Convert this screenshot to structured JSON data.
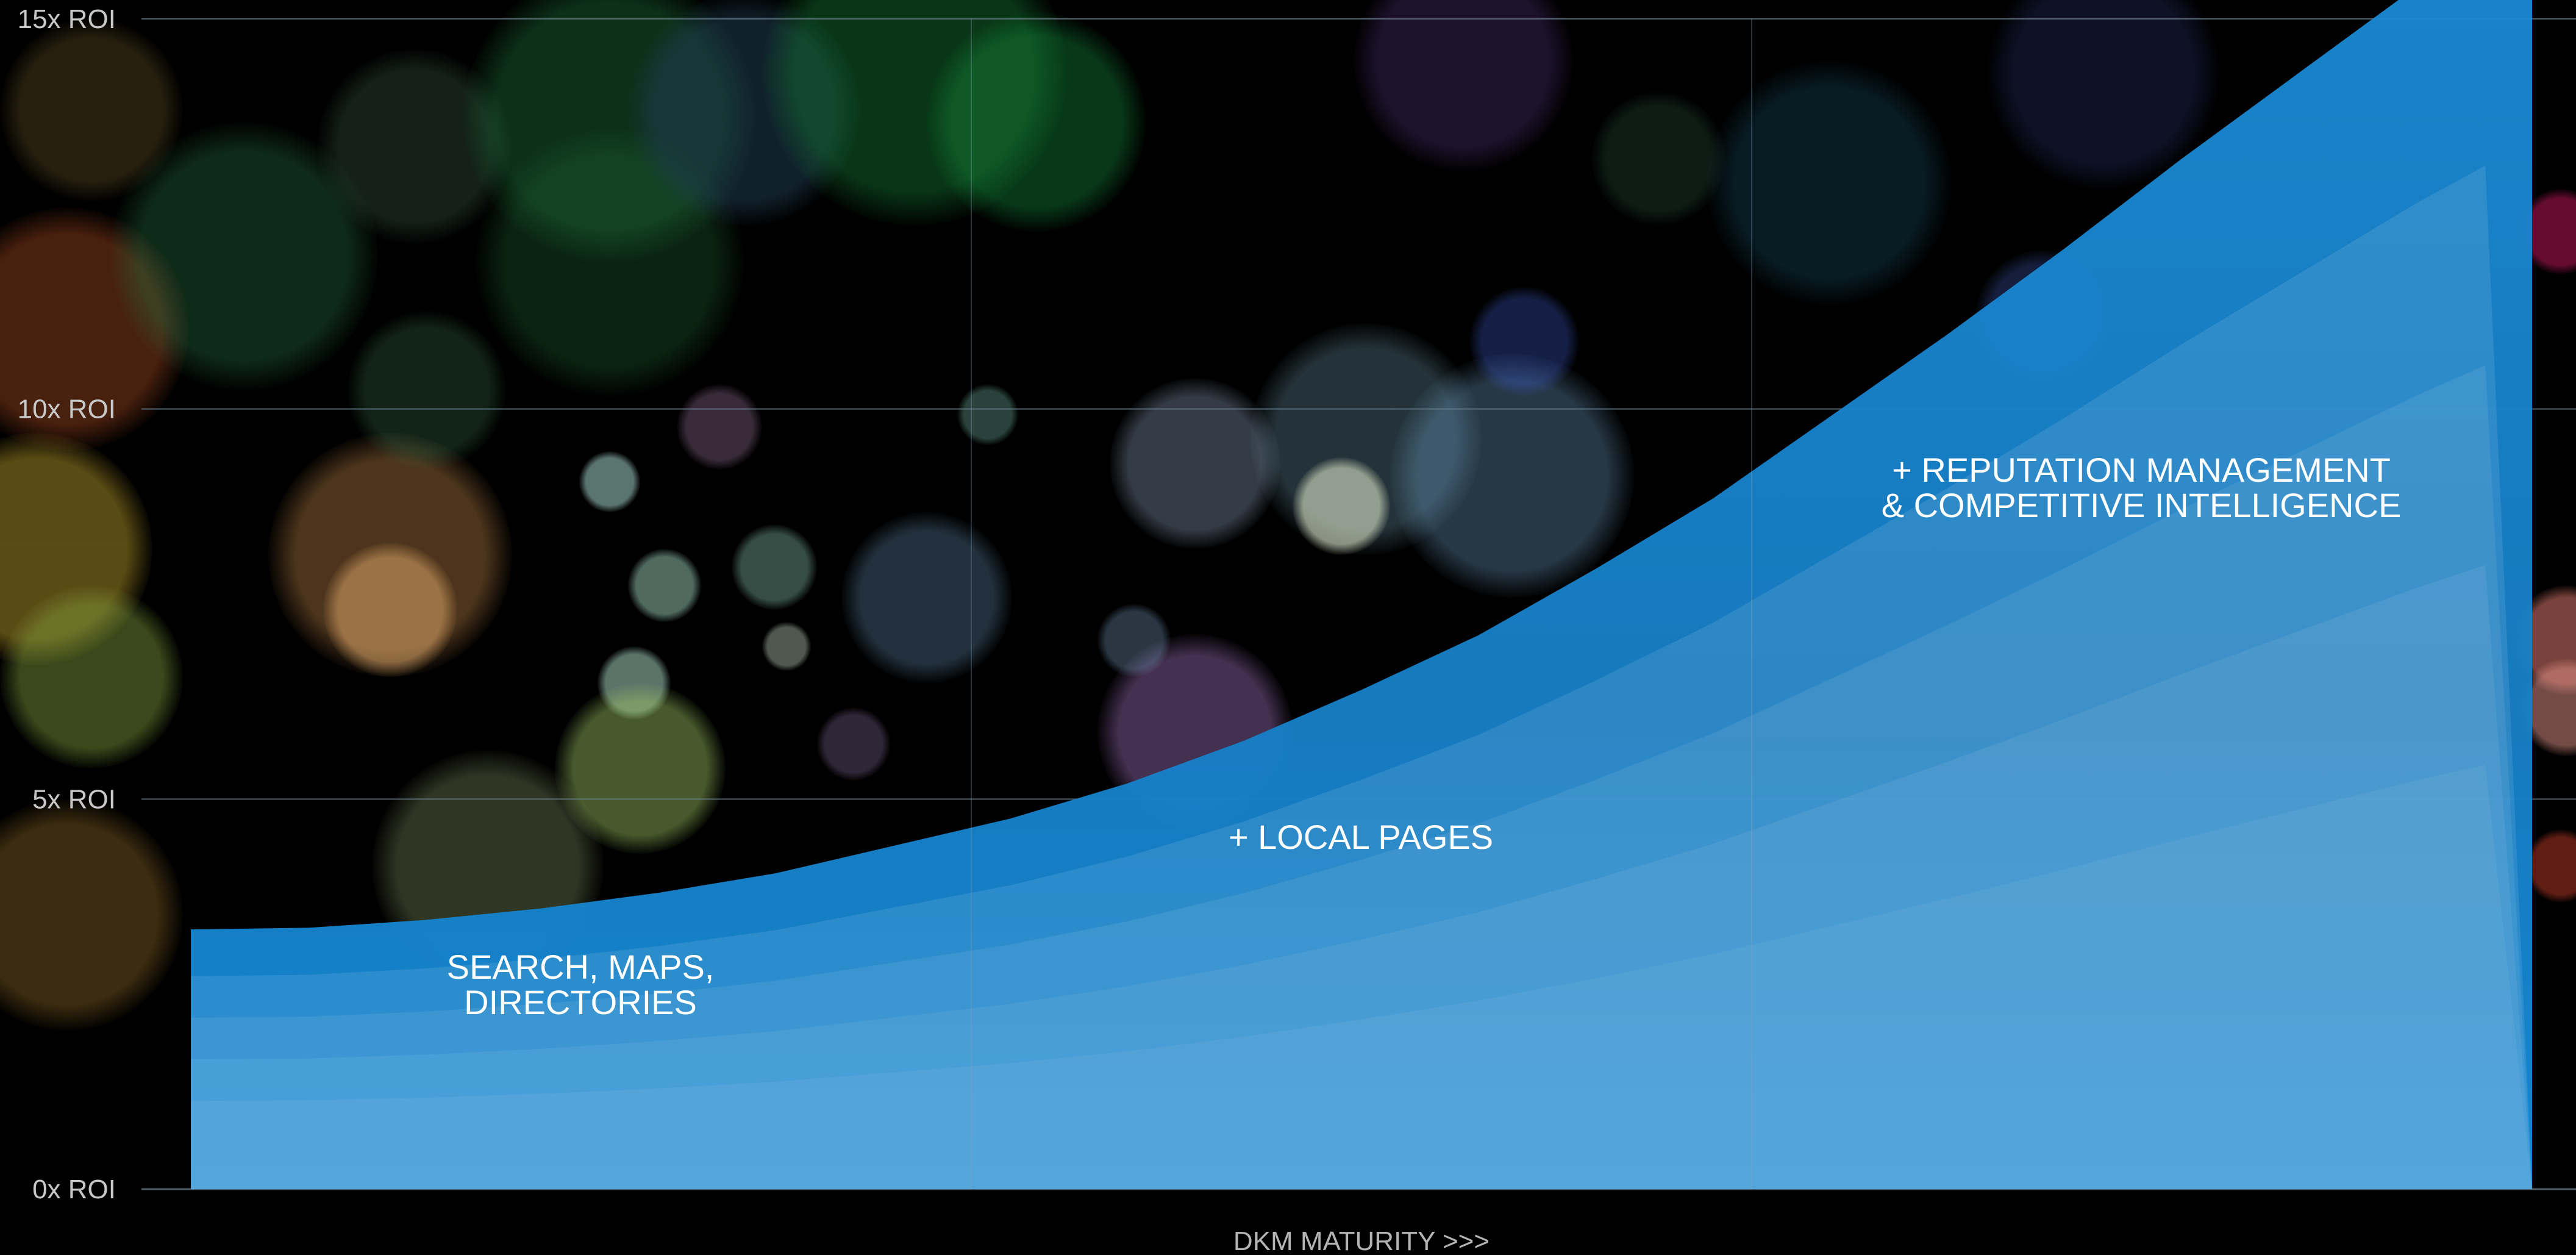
{
  "chart_data": {
    "type": "area",
    "title": "",
    "xlabel": "DKM MATURITY >>>",
    "ylabel": "",
    "ylim": [
      0,
      15
    ],
    "yticks": [
      {
        "value": 0,
        "label": "0x ROI"
      },
      {
        "value": 5,
        "label": "5x ROI"
      },
      {
        "value": 10,
        "label": "10x ROI"
      },
      {
        "value": 15,
        "label": "15x ROI"
      }
    ],
    "stages": [
      {
        "lines": [
          "SEARCH, MAPS,",
          "DIRECTORIES"
        ],
        "roi_level": 2.5
      },
      {
        "lines": [
          "+ LOCAL PAGES"
        ],
        "roi_level": 4.3
      },
      {
        "lines": [
          "+ REPUTATION MANAGEMENT",
          "& COMPETITIVE INTELLIGENCE"
        ],
        "roi_level": 9.0
      }
    ],
    "curve": {
      "description_points_x_fraction": [
        0.0,
        0.05,
        0.1,
        0.15,
        0.2,
        0.25,
        0.3,
        0.35,
        0.4,
        0.45,
        0.5,
        0.55,
        0.6,
        0.65,
        0.7,
        0.75,
        0.8,
        0.85,
        0.9,
        0.95,
        0.98
      ],
      "y_roi": [
        3.33,
        3.35,
        3.45,
        3.6,
        3.8,
        4.05,
        4.4,
        4.75,
        5.2,
        5.75,
        6.4,
        7.1,
        7.95,
        8.85,
        9.9,
        10.95,
        12.05,
        13.2,
        14.3,
        15.4,
        16.0
      ]
    },
    "grid": true,
    "colors": {
      "area": "#1a8ad4",
      "grid": "#6a7f8e",
      "tick_text": "#c8c8c8",
      "xlabel_text": "#b4b4b4",
      "background": "#000000"
    }
  }
}
